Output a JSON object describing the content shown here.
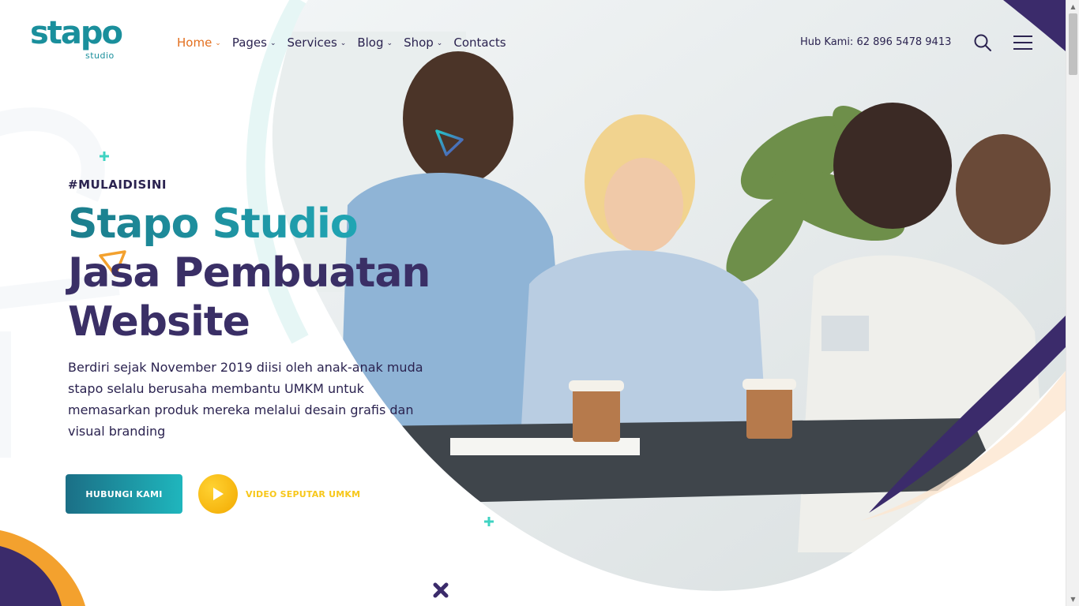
{
  "brand": {
    "name": "stapo",
    "sub": "studio"
  },
  "nav": {
    "items": [
      {
        "label": "Home",
        "caret": "⌄",
        "active": true
      },
      {
        "label": "Pages",
        "caret": "⌄"
      },
      {
        "label": "Services",
        "caret": "⌄"
      },
      {
        "label": "Blog",
        "caret": "⌄"
      },
      {
        "label": "Shop",
        "caret": "⌄"
      },
      {
        "label": "Contacts"
      }
    ]
  },
  "header": {
    "phone": "Hub Kami: 62 896 5478 9413",
    "search_icon": "search-icon",
    "menu_icon": "hamburger-menu-icon"
  },
  "hero": {
    "tag": "#MULAIDISINI",
    "title_line1": "Stapo Studio",
    "title_line2": "Jasa Pembuatan",
    "title_line3": "Website",
    "description": "Berdiri sejak November 2019 diisi oleh anak-anak muda stapo selalu berusaha membantu UMKM untuk memasarkan produk mereka melalui desain grafis dan visual branding",
    "primary_button": "HUBUNGI KAMI",
    "video_label": "VIDEO SEPUTAR UMKM"
  },
  "colors": {
    "accent_orange": "#e36f1e",
    "teal": "#1f8fa3",
    "navy": "#3a2f66",
    "yellow": "#f7c71a",
    "purple": "#3b2b6b",
    "peach": "#fde6cf"
  }
}
